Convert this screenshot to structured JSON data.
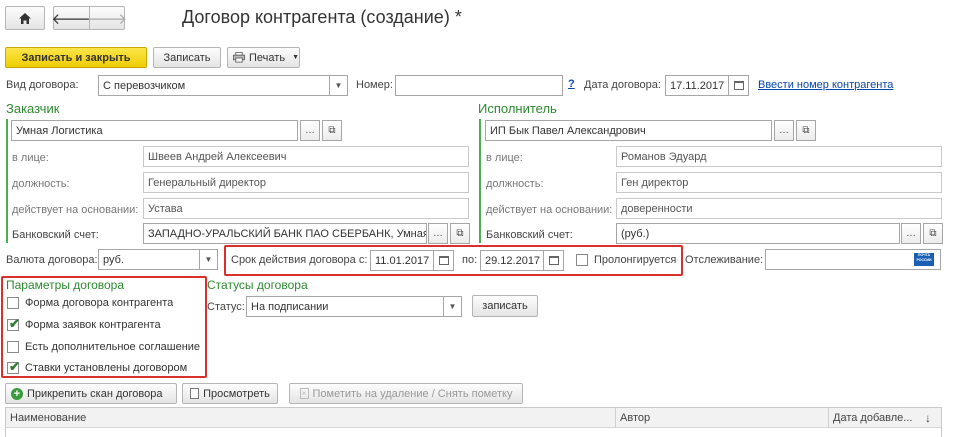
{
  "nav": {
    "home_icon": "home-icon",
    "back_icon": "arrow-left-icon",
    "forward_icon": "arrow-right-icon"
  },
  "window_title": "Договор контрагента (создание) *",
  "toolbar": {
    "save_close": "Записать и закрыть",
    "save": "Записать",
    "print": "Печать"
  },
  "header": {
    "contract_type_label": "Вид договора:",
    "contract_type_value": "С перевозчиком",
    "number_label": "Номер:",
    "number_value": "",
    "help": "?",
    "date_label": "Дата договора:",
    "date_value": "17.11.2017",
    "enter_number_link": "Ввести номер контрагента"
  },
  "customer": {
    "title": "Заказчик",
    "name": "Умная Логистика",
    "person_label": "в лице:",
    "person_value": "Швеев Андрей Алексеевич",
    "position_label": "должность:",
    "position_value": "Генеральный директор",
    "basis_label": "действует на основании:",
    "basis_value": "Устава",
    "bank_label": "Банковский счет:",
    "bank_value": "ЗАПАДНО-УРАЛЬСКИЙ БАНК ПАО СБЕРБАНК, Умная"
  },
  "contractor": {
    "title": "Исполнитель",
    "name": "ИП Бык Павел Александрович",
    "person_label": "в лице:",
    "person_value": "Романов Эдуард",
    "position_label": "должность:",
    "position_value": "Ген директор",
    "basis_label": "действует на основании:",
    "basis_value": "доверенности",
    "bank_label": "Банковский счет:",
    "bank_value": "(руб.)"
  },
  "terms": {
    "currency_label": "Валюта договора:",
    "currency_value": "руб.",
    "validity_label": "Срок действия договора с:",
    "validity_from": "11.01.2017",
    "validity_to_label": "по:",
    "validity_to": "29.12.2017",
    "prolong_label": "Пролонгируется",
    "tracking_label": "Отслеживание:",
    "tracking_value": "",
    "post_logo_line1": "ПОЧТА",
    "post_logo_line2": "РОССИИ"
  },
  "params": {
    "title": "Параметры договора",
    "items": [
      {
        "label": "Форма договора контрагента",
        "checked": false
      },
      {
        "label": "Форма заявок контрагента",
        "checked": true
      },
      {
        "label": "Есть дополнительное соглашение",
        "checked": false
      },
      {
        "label": "Ставки установлены договором",
        "checked": true
      }
    ]
  },
  "statuses": {
    "title": "Статусы договора",
    "status_label": "Статус:",
    "status_value": "На подписании",
    "write_button": "записать"
  },
  "files": {
    "attach": "Прикрепить скан договора",
    "view": "Просмотреть",
    "mark_delete": "Пометить на удаление / Снять пометку",
    "columns": [
      "Наименование",
      "Автор",
      "Дата добавле..."
    ],
    "sort_icon": "↓"
  }
}
